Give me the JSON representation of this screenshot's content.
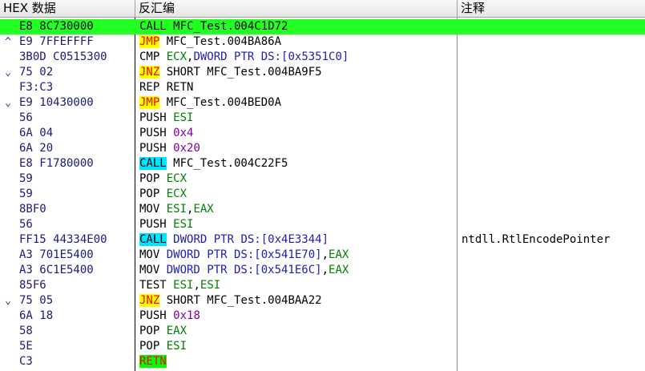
{
  "columns": {
    "hex": "HEX 数据",
    "disasm": "反汇编",
    "comment": "注释"
  },
  "rows": [
    {
      "mark": "",
      "hex": "E8 8C730000",
      "selected": true,
      "tokens": [
        {
          "t": "CALL",
          "c": "call"
        },
        {
          "t": " MFC_Test.004C1D72",
          "c": "txt"
        }
      ],
      "comment": ""
    },
    {
      "mark": "^",
      "hex": "E9 7FFEFFFF",
      "tokens": [
        {
          "t": "JMP",
          "c": "jmp"
        },
        {
          "t": " MFC_Test.004BA86A",
          "c": "txt"
        }
      ],
      "comment": ""
    },
    {
      "mark": "",
      "hex": "3B0D C0515300",
      "tokens": [
        {
          "t": "CMP ",
          "c": "mn"
        },
        {
          "t": "ECX",
          "c": "reg"
        },
        {
          "t": ",",
          "c": "txt"
        },
        {
          "t": "DWORD PTR DS:[0x5351C0]",
          "c": "mem"
        }
      ],
      "comment": ""
    },
    {
      "mark": "v",
      "hex": "75 02",
      "tokens": [
        {
          "t": "JNZ",
          "c": "jmp"
        },
        {
          "t": " SHORT MFC_Test.004BA9F5",
          "c": "txt"
        }
      ],
      "comment": ""
    },
    {
      "mark": "",
      "hex": "F3:C3",
      "tokens": [
        {
          "t": "REP RETN",
          "c": "mn"
        }
      ],
      "comment": ""
    },
    {
      "mark": "v",
      "hex": "E9 10430000",
      "tokens": [
        {
          "t": "JMP",
          "c": "jmp"
        },
        {
          "t": " MFC_Test.004BED0A",
          "c": "txt"
        }
      ],
      "comment": ""
    },
    {
      "mark": "",
      "hex": "56",
      "tokens": [
        {
          "t": "PUSH ",
          "c": "mn"
        },
        {
          "t": "ESI",
          "c": "reg"
        }
      ],
      "comment": ""
    },
    {
      "mark": "",
      "hex": "6A 04",
      "tokens": [
        {
          "t": "PUSH ",
          "c": "mn"
        },
        {
          "t": "0x4",
          "c": "imm"
        }
      ],
      "comment": ""
    },
    {
      "mark": "",
      "hex": "6A 20",
      "tokens": [
        {
          "t": "PUSH ",
          "c": "mn"
        },
        {
          "t": "0x20",
          "c": "imm"
        }
      ],
      "comment": ""
    },
    {
      "mark": "",
      "hex": "E8 F1780000",
      "tokens": [
        {
          "t": "CALL",
          "c": "call"
        },
        {
          "t": " MFC_Test.004C22F5",
          "c": "txt"
        }
      ],
      "comment": ""
    },
    {
      "mark": "",
      "hex": "59",
      "tokens": [
        {
          "t": "POP ",
          "c": "mn"
        },
        {
          "t": "ECX",
          "c": "reg"
        }
      ],
      "comment": ""
    },
    {
      "mark": "",
      "hex": "59",
      "tokens": [
        {
          "t": "POP ",
          "c": "mn"
        },
        {
          "t": "ECX",
          "c": "reg"
        }
      ],
      "comment": ""
    },
    {
      "mark": "",
      "hex": "8BF0",
      "tokens": [
        {
          "t": "MOV ",
          "c": "mn"
        },
        {
          "t": "ESI",
          "c": "reg"
        },
        {
          "t": ",",
          "c": "txt"
        },
        {
          "t": "EAX",
          "c": "reg"
        }
      ],
      "comment": ""
    },
    {
      "mark": "",
      "hex": "56",
      "tokens": [
        {
          "t": "PUSH ",
          "c": "mn"
        },
        {
          "t": "ESI",
          "c": "reg"
        }
      ],
      "comment": ""
    },
    {
      "mark": "",
      "hex": "FF15 44334E00",
      "tokens": [
        {
          "t": "CALL",
          "c": "call"
        },
        {
          "t": " ",
          "c": "txt"
        },
        {
          "t": "DWORD PTR DS:[0x4E3344]",
          "c": "mem"
        }
      ],
      "comment": "ntdll.RtlEncodePointer"
    },
    {
      "mark": "",
      "hex": "A3 701E5400",
      "tokens": [
        {
          "t": "MOV ",
          "c": "mn"
        },
        {
          "t": "DWORD PTR DS:[0x541E70]",
          "c": "mem"
        },
        {
          "t": ",",
          "c": "txt"
        },
        {
          "t": "EAX",
          "c": "reg"
        }
      ],
      "comment": ""
    },
    {
      "mark": "",
      "hex": "A3 6C1E5400",
      "tokens": [
        {
          "t": "MOV ",
          "c": "mn"
        },
        {
          "t": "DWORD PTR DS:[0x541E6C]",
          "c": "mem"
        },
        {
          "t": ",",
          "c": "txt"
        },
        {
          "t": "EAX",
          "c": "reg"
        }
      ],
      "comment": ""
    },
    {
      "mark": "",
      "hex": "85F6",
      "tokens": [
        {
          "t": "TEST ",
          "c": "mn"
        },
        {
          "t": "ESI",
          "c": "reg"
        },
        {
          "t": ",",
          "c": "txt"
        },
        {
          "t": "ESI",
          "c": "reg"
        }
      ],
      "comment": ""
    },
    {
      "mark": "v",
      "hex": "75 05",
      "tokens": [
        {
          "t": "JNZ",
          "c": "jmp"
        },
        {
          "t": " SHORT MFC_Test.004BAA22",
          "c": "txt"
        }
      ],
      "comment": ""
    },
    {
      "mark": "",
      "hex": "6A 18",
      "tokens": [
        {
          "t": "PUSH ",
          "c": "mn"
        },
        {
          "t": "0x18",
          "c": "imm"
        }
      ],
      "comment": ""
    },
    {
      "mark": "",
      "hex": "58",
      "tokens": [
        {
          "t": "POP ",
          "c": "mn"
        },
        {
          "t": "EAX",
          "c": "reg"
        }
      ],
      "comment": ""
    },
    {
      "mark": "",
      "hex": "5E",
      "tokens": [
        {
          "t": "POP ",
          "c": "mn"
        },
        {
          "t": "ESI",
          "c": "reg"
        }
      ],
      "comment": ""
    },
    {
      "mark": "",
      "hex": "C3",
      "tokens": [
        {
          "t": "RETN",
          "c": "retn"
        }
      ],
      "comment": ""
    }
  ],
  "colors": {
    "selected_row": "#22ff22",
    "call_highlight": "#00e5ff",
    "jump_highlight": "#ffff00",
    "retn_highlight": "#00ff00",
    "register": "#008000",
    "immediate": "#8000a0",
    "memory": "#1e1eb4",
    "hex_bytes": "#1a1a7a"
  },
  "icons": {
    "jump_up_marker": "arrow-up-icon",
    "jump_down_marker": "arrow-down-icon"
  }
}
